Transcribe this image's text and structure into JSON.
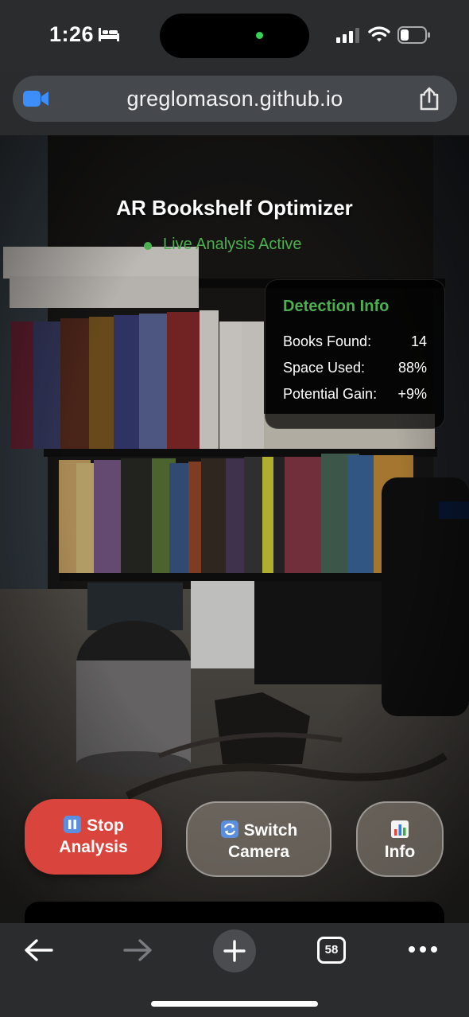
{
  "status_bar": {
    "time": "1:26"
  },
  "browser": {
    "url": "greglomason.github.io",
    "tab_count": "58"
  },
  "app": {
    "title": "AR Bookshelf Optimizer",
    "status": "Live Analysis Active",
    "detection_info": {
      "title": "Detection Info",
      "rows": [
        {
          "label": "Books Found:",
          "value": "14"
        },
        {
          "label": "Space Used:",
          "value": "88%"
        },
        {
          "label": "Potential Gain:",
          "value": "+9%"
        }
      ]
    },
    "controls": {
      "stop": {
        "line1": "Stop",
        "line2": "Analysis"
      },
      "switch": {
        "line1": "Switch",
        "line2": "Camera"
      },
      "info": {
        "line1": "Info"
      }
    }
  },
  "colors": {
    "accent_green": "#4caf50",
    "stop_red": "#d9453d"
  }
}
